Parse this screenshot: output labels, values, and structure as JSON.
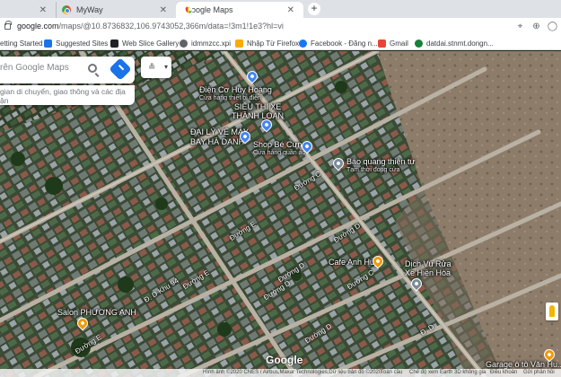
{
  "tabs": [
    {
      "title": "",
      "icon": "tab-favicon"
    },
    {
      "title": "MyWay",
      "icon": "chrome-icon"
    },
    {
      "title": "Google Maps",
      "icon": "google-maps-icon"
    }
  ],
  "address_bar": {
    "url_host": "google.com",
    "url_path": "/maps/@10.8736832,106.9743052,366m/data=!3m1!1e3?hl=vi"
  },
  "bookmarks": [
    {
      "label": "etting Started",
      "color": "#e8710a"
    },
    {
      "label": "Suggested Sites",
      "color": "#1a73e8"
    },
    {
      "label": "Web Slice Gallery",
      "color": "#202124"
    },
    {
      "label": "idmmzcc.xpi",
      "color": "#5f6368"
    },
    {
      "label": "Nhập Từ Firefox",
      "color": "#f9ab00"
    },
    {
      "label": "Facebook - Đăng n...",
      "color": "#1877f2"
    },
    {
      "label": "Gmail",
      "color": "#ea4335"
    },
    {
      "label": "datdai.stnmt.dongn...",
      "color": "#188038"
    }
  ],
  "search": {
    "placeholder": "rên Google Maps",
    "hint": "gian di chuyển, giao thông và các địa ận"
  },
  "places": [
    {
      "name": "Điện Cơ Huy Hoàng",
      "sub": "Cửa hàng thiết bị điện"
    },
    {
      "name": "SIÊU THỊ XE",
      "sub": ""
    },
    {
      "name": "THÀNH LOAN",
      "sub": ""
    },
    {
      "name": "ĐẠI LÝ VÉ MÁY",
      "sub": ""
    },
    {
      "name": "BAY HÀ DANH",
      "sub": ""
    },
    {
      "name": "Shop Bé Cưng",
      "sub": "Cửa hàng quần áo"
    },
    {
      "name": "Báo quang thiện tự",
      "sub": "Tạm thời đóng cửa"
    },
    {
      "name": "Cafe Anh Huy",
      "sub": ""
    },
    {
      "name": "Dịch Vụ Rửa",
      "sub": ""
    },
    {
      "name": "Xe Hiền Hòa",
      "sub": ""
    },
    {
      "name": "Salon PHƯƠNG ANH",
      "sub": ""
    },
    {
      "name": "Garage ô tô Văn Hu...",
      "sub": ""
    }
  ],
  "roads": [
    "Đường C",
    "Đường D",
    "Đường E",
    "Đường D",
    "Đường D",
    "Đường E",
    "Đường C",
    "Đ. D Khu 94",
    "Đường E",
    "Đường D",
    "Đ. D"
  ],
  "map_logo": "Google",
  "footer": {
    "imagery": "Hình ảnh ©2020 CNES / Airbus,Maxar Technologies,Dữ liệu bản đồ ©2020",
    "country": "Toàn cầu",
    "view": "Chế độ xem Earth 3D không gia",
    "terms": "Điều khoản",
    "feedback": "Gửi phản hồi"
  }
}
